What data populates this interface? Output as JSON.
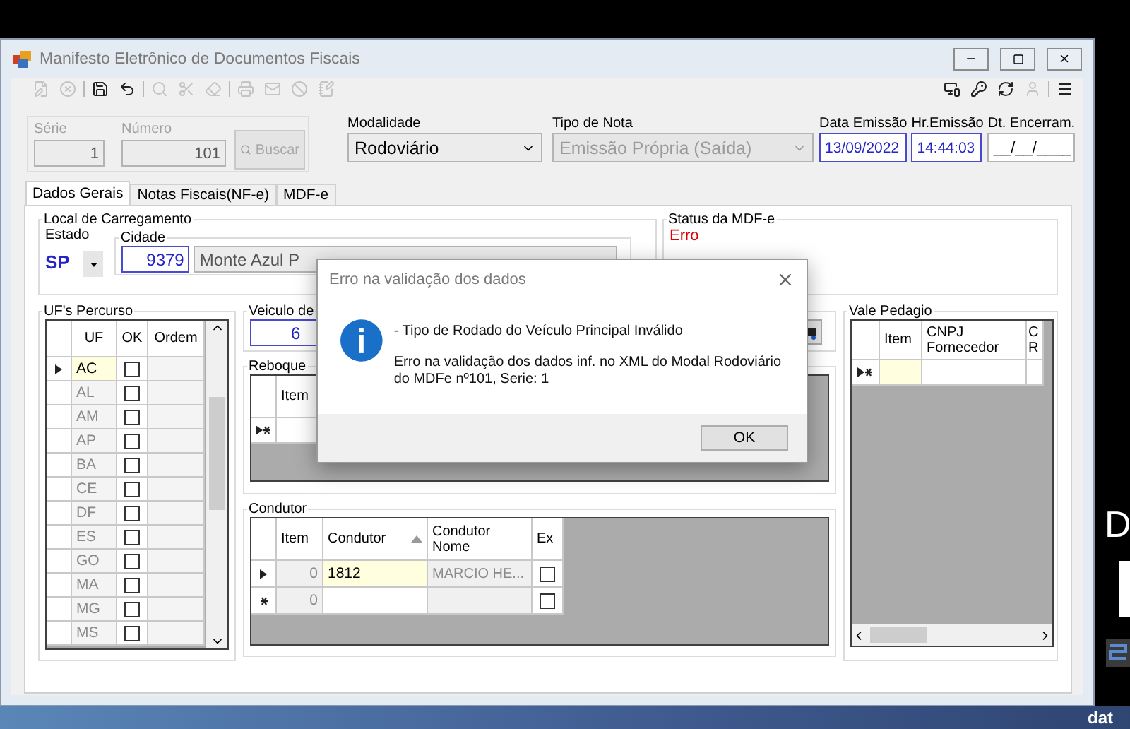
{
  "window": {
    "title": "Manifesto Eletrônico de Documentos Fiscais"
  },
  "toolbar": {
    "groups": [
      [
        {
          "kind": "edit",
          "disabled": true
        },
        {
          "kind": "cancel",
          "disabled": true
        }
      ],
      [
        {
          "kind": "save",
          "disabled": false
        },
        {
          "kind": "undo",
          "disabled": false
        }
      ],
      [
        {
          "kind": "zoom",
          "disabled": true
        },
        {
          "kind": "tools",
          "disabled": true
        },
        {
          "kind": "eraser",
          "disabled": true
        }
      ],
      [
        {
          "kind": "print",
          "disabled": true
        },
        {
          "kind": "mail",
          "disabled": true
        },
        {
          "kind": "block",
          "disabled": true
        },
        {
          "kind": "note",
          "disabled": true
        }
      ]
    ],
    "right_groups": [
      [
        {
          "kind": "screen",
          "disabled": false
        },
        {
          "kind": "key",
          "disabled": false
        },
        {
          "kind": "refresh",
          "disabled": false
        },
        {
          "kind": "user",
          "disabled": true
        }
      ],
      [
        {
          "kind": "menu",
          "disabled": false
        }
      ]
    ]
  },
  "header": {
    "serie": {
      "label": "Série",
      "value": "1",
      "disabled": true
    },
    "numero": {
      "label": "Número",
      "value": "101",
      "disabled": true
    },
    "buscar": {
      "label": "Buscar",
      "disabled": true
    },
    "modalidade": {
      "label": "Modalidade",
      "value": "Rodoviário",
      "disabled": false
    },
    "tipo_nota": {
      "label": "Tipo de Nota",
      "value": "Emissão Própria (Saída)",
      "disabled": true
    },
    "data_emissao": {
      "label": "Data Emissão",
      "value": "13/09/2022"
    },
    "hr_emissao": {
      "label": "Hr.Emissão",
      "value": "14:44:03"
    },
    "dt_encerram": {
      "label": "Dt. Encerram.",
      "value": "__/__/____"
    }
  },
  "tabs": [
    {
      "label": "Dados Gerais",
      "selected": true
    },
    {
      "label": "Notas Fiscais(NF-e)",
      "selected": false
    },
    {
      "label": "MDF-e",
      "selected": false
    }
  ],
  "local_carregamento": {
    "title": "Local de Carregamento",
    "estado_label": "Estado",
    "estado": "SP",
    "cidade_label": "Cidade",
    "cidade_codigo": "9379",
    "cidade_nome": "Monte Azul P"
  },
  "status": {
    "title": "Status da MDF-e",
    "value": "Erro"
  },
  "ufs_percurso": {
    "title": "UF's Percurso",
    "columns": [
      "UF",
      "OK",
      "Ordem"
    ],
    "rows": [
      {
        "uf": "AC",
        "selected": true,
        "checked": false
      },
      {
        "uf": "AL",
        "selected": false,
        "checked": false
      },
      {
        "uf": "AM",
        "selected": false,
        "checked": false
      },
      {
        "uf": "AP",
        "selected": false,
        "checked": false
      },
      {
        "uf": "BA",
        "selected": false,
        "checked": false
      },
      {
        "uf": "CE",
        "selected": false,
        "checked": false
      },
      {
        "uf": "DF",
        "selected": false,
        "checked": false
      },
      {
        "uf": "ES",
        "selected": false,
        "checked": false
      },
      {
        "uf": "GO",
        "selected": false,
        "checked": false
      },
      {
        "uf": "MA",
        "selected": false,
        "checked": false
      },
      {
        "uf": "MG",
        "selected": false,
        "checked": false
      },
      {
        "uf": "MS",
        "selected": false,
        "checked": false
      }
    ]
  },
  "veiculo": {
    "title": "Veiculo de",
    "value": "6"
  },
  "reboque": {
    "title": "Reboque",
    "columns": [
      {
        "label": "Item",
        "sorted": false
      }
    ],
    "rows": [
      {
        "kind": "new",
        "current": true
      }
    ]
  },
  "condutor": {
    "title": "Condutor",
    "columns": [
      {
        "label": "Item",
        "sorted": false
      },
      {
        "label": "Condutor",
        "sorted": true
      },
      {
        "label": "Condutor Nome",
        "sorted": false
      },
      {
        "label": "Ex",
        "sorted": false
      }
    ],
    "rows": [
      {
        "kind": "data",
        "current": true,
        "item": "0",
        "condutor": "1812",
        "nome": "MARCIO HE...",
        "ex": false
      },
      {
        "kind": "new",
        "current": false,
        "item": "0",
        "ex": false
      }
    ]
  },
  "vale_pedagio": {
    "title": "Vale Pedagio",
    "columns": [
      {
        "label": "Item",
        "sorted": false
      },
      {
        "label": "CNPJ Fornecedor",
        "sorted": false
      },
      {
        "label": "C R",
        "sorted": false
      }
    ],
    "rows": [
      {
        "kind": "new",
        "current": true
      }
    ]
  },
  "dialog": {
    "title": "Erro na validação dos dados",
    "message": "- Tipo de Rodado do Veículo Principal Inválido",
    "detail": "Erro na validação dos dados inf. no XML do Modal Rodoviário do MDFe nº101, Serie: 1",
    "button": "OK"
  },
  "desktop": {
    "texts": [
      "D",
      "dat"
    ]
  }
}
